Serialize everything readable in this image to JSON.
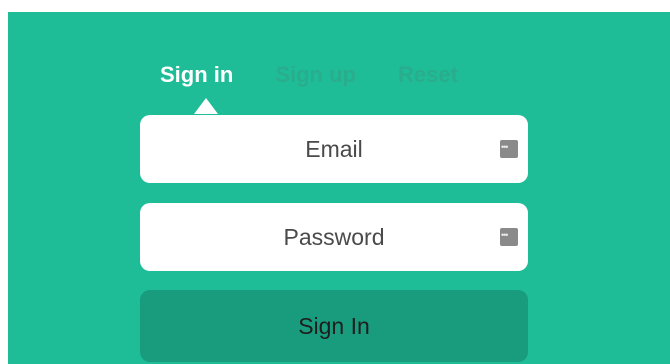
{
  "tabs": [
    {
      "label": "Sign in",
      "active": true
    },
    {
      "label": "Sign up",
      "active": false
    },
    {
      "label": "Reset",
      "active": false
    }
  ],
  "form": {
    "email_placeholder": "Email",
    "email_value": "",
    "password_placeholder": "Password",
    "password_value": "",
    "submit_label": "Sign In"
  },
  "icons": {
    "field_icon": "password-manager-key-icon"
  },
  "colors": {
    "background": "#1fbc98",
    "active_tab": "#ffffff",
    "inactive_tab": "#29ad8d",
    "submit_button": "#189c7d"
  }
}
